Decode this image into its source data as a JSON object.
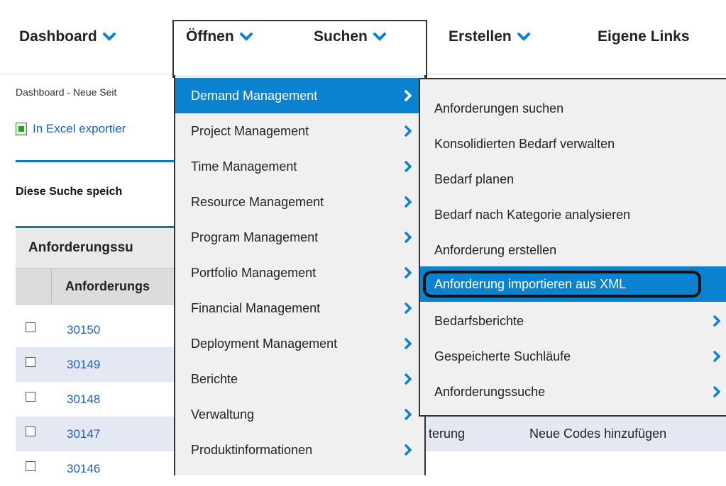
{
  "nav": {
    "items": [
      {
        "label": "Dashboard"
      },
      {
        "label": "Öffnen"
      },
      {
        "label": "Suchen"
      },
      {
        "label": "Erstellen"
      },
      {
        "label": "Eigene Links"
      }
    ]
  },
  "page": {
    "breadcrumb": "Dashboard - Neue Seit",
    "excel_export": "In Excel exportier",
    "save_search": "Diese Suche speich",
    "grid_title": "Anforderungssu",
    "grid_header": "Anforderungs",
    "rows": [
      {
        "id": "30150",
        "c3": "",
        "c4": ""
      },
      {
        "id": "30149",
        "c3": "",
        "c4": ""
      },
      {
        "id": "30148",
        "c3": "",
        "c4": ""
      },
      {
        "id": "30147",
        "c3": "terung",
        "c4": "Neue Codes hinzufügen"
      },
      {
        "id": "30146",
        "c3": "",
        "c4": ""
      }
    ]
  },
  "menu_open": {
    "items": [
      {
        "label": "Demand Management"
      },
      {
        "label": "Project Management"
      },
      {
        "label": "Time Management"
      },
      {
        "label": "Resource Management"
      },
      {
        "label": "Program Management"
      },
      {
        "label": "Portfolio Management"
      },
      {
        "label": "Financial Management"
      },
      {
        "label": "Deployment Management"
      },
      {
        "label": "Berichte"
      },
      {
        "label": "Verwaltung"
      },
      {
        "label": "Produktinformationen"
      }
    ]
  },
  "submenu_demand": {
    "items": [
      {
        "label": "Anforderungen suchen"
      },
      {
        "label": "Konsolidierten Bedarf verwalten"
      },
      {
        "label": "Bedarf planen"
      },
      {
        "label": "Bedarf nach Kategorie analysieren"
      },
      {
        "label": "Anforderung erstellen"
      },
      {
        "label": "Anforderung importieren aus XML"
      },
      {
        "label": "Bedarfsberichte"
      },
      {
        "label": "Gespeicherte Suchläufe"
      },
      {
        "label": "Anforderungssuche"
      }
    ]
  },
  "colors": {
    "accent_blue": "#0a82d0",
    "link_blue": "#1d5fbf",
    "row_alt": "#e3e8f3"
  },
  "icons": [
    "chevron-down-icon",
    "chevron-right-icon",
    "excel-icon",
    "checkbox"
  ]
}
